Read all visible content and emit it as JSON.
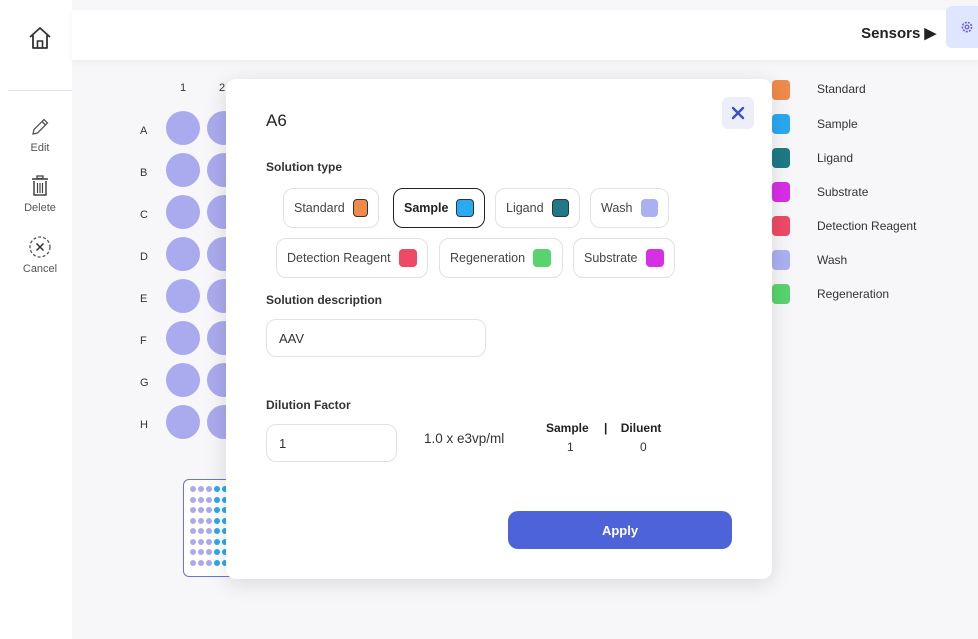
{
  "rail": {
    "edit_label": "Edit",
    "delete_label": "Delete",
    "cancel_label": "Cancel"
  },
  "header": {
    "sensors_label": "Sensors ▶"
  },
  "plate": {
    "columns": [
      "1",
      "2"
    ],
    "rows": [
      "A",
      "B",
      "C",
      "D",
      "E",
      "F",
      "G",
      "H"
    ],
    "well_color": "#aaaaee"
  },
  "legend": [
    {
      "label": "Standard",
      "color": "#f08a4b"
    },
    {
      "label": "Sample",
      "color": "#29a9f2"
    },
    {
      "label": "Ligand",
      "color": "#1e7a86"
    },
    {
      "label": "Substrate",
      "color": "#d62fe6"
    },
    {
      "label": "Detection Reagent",
      "color": "#ee4a66"
    },
    {
      "label": "Wash",
      "color": "#aab0f2"
    },
    {
      "label": "Regeneration",
      "color": "#58d36e"
    }
  ],
  "modal": {
    "title": "A6",
    "solution_type_label": "Solution type",
    "solution_types": [
      {
        "label": "Standard",
        "color": "#f08a4b"
      },
      {
        "label": "Sample",
        "color": "#29a9f2",
        "selected": true
      },
      {
        "label": "Ligand",
        "color": "#1e7a86"
      },
      {
        "label": "Wash",
        "color": "#aab0f2"
      },
      {
        "label": "Detection Reagent",
        "color": "#ee4a66"
      },
      {
        "label": "Regeneration",
        "color": "#58d36e"
      },
      {
        "label": "Substrate",
        "color": "#d62fe6"
      }
    ],
    "description_label": "Solution description",
    "description_value": "AAV",
    "dilution_label": "Dilution Factor",
    "dilution_value": "1",
    "concentration": "1.0 x e3vp/ml",
    "ratio": {
      "sample_label": "Sample",
      "separator": "|",
      "diluent_label": "Diluent",
      "sample_value": "1",
      "diluent_value": "0"
    },
    "apply_label": "Apply"
  },
  "colors": {
    "accent": "#4d63d9",
    "close_icon": "#3d4fc4"
  }
}
